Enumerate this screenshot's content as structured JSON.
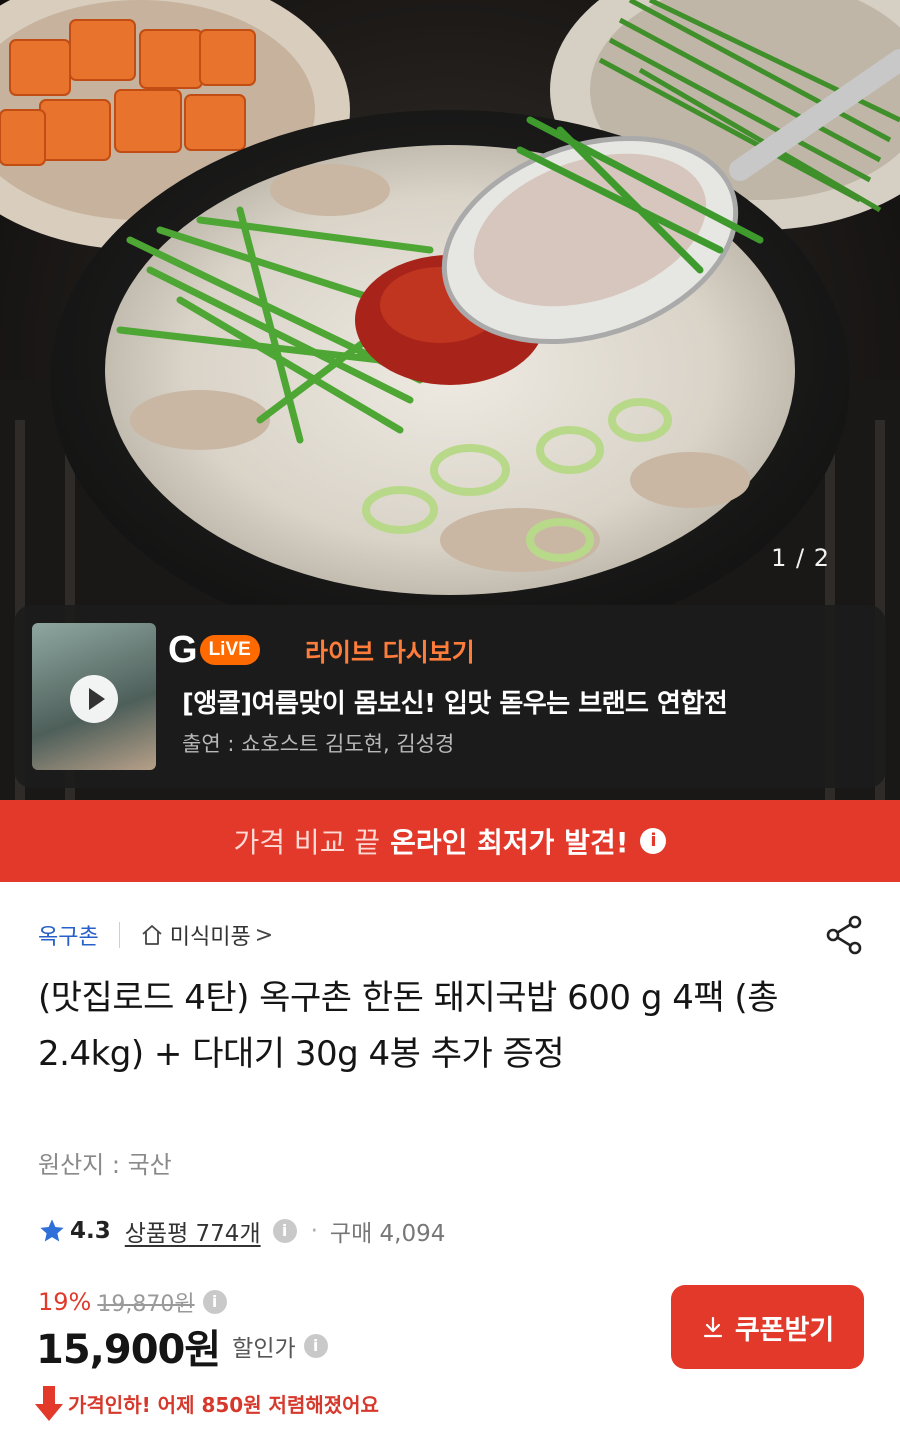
{
  "hero": {
    "page_indicator": "1 / 2"
  },
  "live": {
    "logo_letter": "G",
    "logo_pill": "LiVE",
    "replay_label": "라이브 다시보기",
    "title": "[앵콜]여름맞이 몸보신! 입맛 돋우는 브랜드 연합전",
    "cast": "출연 : 쇼호스트 김도현, 김성경",
    "accent": "#ff6a00"
  },
  "banner": {
    "light": "가격 비교 끝",
    "bold": "온라인 최저가 발견!",
    "info_icon": "i",
    "color": "#e2392b"
  },
  "product": {
    "brand": "옥구촌",
    "store": "미식미풍",
    "store_chevron": ">",
    "title": "(맛집로드 4탄) 옥구촌 한돈 돼지국밥 600 g 4팩 (총2.4kg) + 다대기 30g 4봉 추가 증정",
    "origin": "원산지 : 국산",
    "rating": "4.3",
    "reviews": "상품평 774개",
    "info_icon": "i",
    "bullet": "·",
    "purchases": "구매 4,094",
    "discount_rate": "19%",
    "original_price": "19,870원",
    "price": "15,900원",
    "price_label": "할인가",
    "coupon_button": "쿠폰받기",
    "price_drop": "가격인하! 어제 850원 저렴해졌어요"
  },
  "icons": {
    "home": "home-icon",
    "share": "share-icon",
    "star": "star-icon",
    "download": "download-icon",
    "play": "play-icon",
    "price_drop": "down-arrow-icon"
  }
}
